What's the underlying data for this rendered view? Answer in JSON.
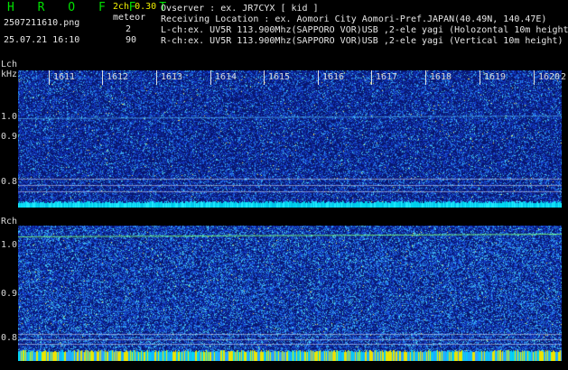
{
  "header": {
    "brand": "H R O F F T",
    "mode": "2ch 0.30",
    "meteor_label": "meteor",
    "meteor_count": "2",
    "scale_value": "90",
    "filename": "2507211610.png",
    "datetime": "25.07.21 16:10"
  },
  "station": {
    "observer": "Ovserver           : ex. JR7CYX [ kid ]",
    "location": "Receiving Location : ex. Aomori City Aomori-Pref.JAPAN(40.49N, 140.47E)",
    "lch": "L-ch:ex. UV5R 113.900Mhz(SAPPORO VOR)USB ,2-ele yagi (Holozontal 10m height",
    "rch": "R-ch:ex. UV5R 113.900Mhz(SAPPORO VOR)USB ,2-ele yagi (Vertical 10m height)"
  },
  "lch_panel": {
    "label": "Lch",
    "unit": "kHz",
    "y_ticks": [
      "1.0",
      "0.9",
      "0.8"
    ]
  },
  "rch_panel": {
    "label": "Rch",
    "y_ticks": [
      "1.0",
      "0.9",
      "0.8"
    ]
  },
  "time_axis": {
    "ticks": [
      "1611",
      "1612",
      "1613",
      "1614",
      "1615",
      "1616",
      "1617",
      "1618",
      "1619",
      "1620",
      "2"
    ]
  },
  "colors": {
    "background": "#000000",
    "brand": "#00e000",
    "waterfall_bg": "#0a1c74",
    "noise_strip": "#00d8f0",
    "noise_strip_r": "#f0e000"
  }
}
